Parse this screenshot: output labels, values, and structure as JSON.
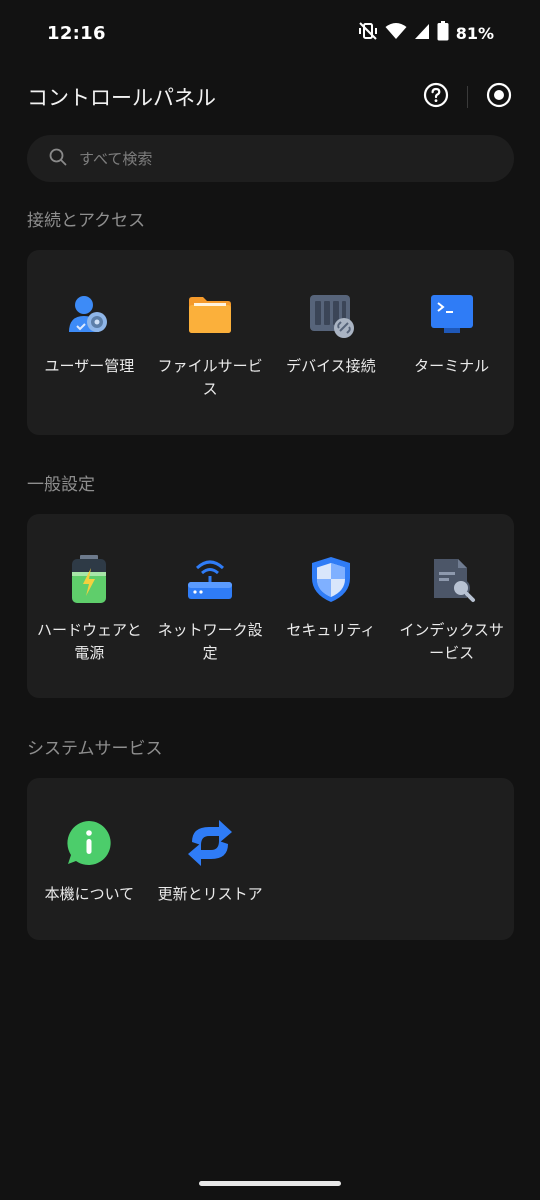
{
  "status": {
    "time": "12:16",
    "battery": "81%",
    "icons": [
      "mute-vibrate-off-icon",
      "wifi-icon",
      "cell-signal-icon",
      "battery-icon"
    ]
  },
  "header": {
    "title": "コントロールパネル",
    "help_icon": "help-circle-icon",
    "settings_icon": "record-circle-icon"
  },
  "search": {
    "placeholder": "すべて検索",
    "icon": "search-icon"
  },
  "sections": [
    {
      "title": "接続とアクセス",
      "items": [
        {
          "label": "ユーザー管理",
          "icon": "user-management-icon"
        },
        {
          "label": "ファイルサービス",
          "icon": "folder-icon"
        },
        {
          "label": "デバイス接続",
          "icon": "device-connection-icon"
        },
        {
          "label": "ターミナル",
          "icon": "terminal-icon"
        }
      ]
    },
    {
      "title": "一般設定",
      "items": [
        {
          "label": "ハードウェアと電源",
          "icon": "battery-power-icon"
        },
        {
          "label": "ネットワーク設定",
          "icon": "router-icon"
        },
        {
          "label": "セキュリティ",
          "icon": "shield-icon"
        },
        {
          "label": "インデックスサービス",
          "icon": "index-search-icon"
        }
      ]
    },
    {
      "title": "システムサービス",
      "items": [
        {
          "label": "本機について",
          "icon": "info-bubble-icon"
        },
        {
          "label": "更新とリストア",
          "icon": "refresh-icon"
        }
      ]
    }
  ],
  "colors": {
    "background": "#121212",
    "card": "#1e1e1e",
    "section_title": "#8e8e8e",
    "accent_blue": "#2f7cf6"
  }
}
